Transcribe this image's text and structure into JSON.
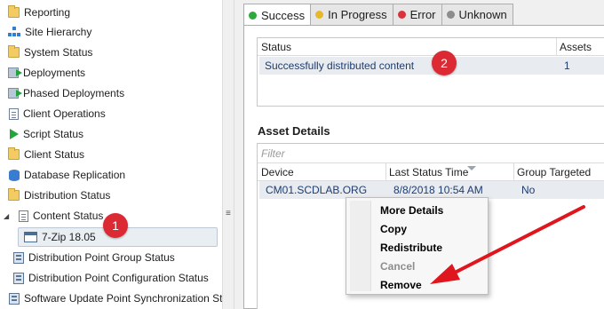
{
  "nav": {
    "items": [
      {
        "label": "Reporting",
        "icon": "folder-icon"
      },
      {
        "label": "Site Hierarchy",
        "icon": "hierarchy-icon"
      },
      {
        "label": "System Status",
        "icon": "folder-icon"
      },
      {
        "label": "Deployments",
        "icon": "deployment-icon"
      },
      {
        "label": "Phased Deployments",
        "icon": "deployment-icon"
      },
      {
        "label": "Client Operations",
        "icon": "document-icon"
      },
      {
        "label": "Script Status",
        "icon": "play-icon"
      },
      {
        "label": "Client Status",
        "icon": "folder-icon"
      },
      {
        "label": "Database Replication",
        "icon": "database-icon"
      },
      {
        "label": "Distribution Status",
        "icon": "folder-icon"
      },
      {
        "label": "Content Status",
        "icon": "document-icon"
      },
      {
        "label": "7-Zip 18.05",
        "icon": "application-icon"
      },
      {
        "label": "Distribution Point Group Status",
        "icon": "server-icon"
      },
      {
        "label": "Distribution Point Configuration Status",
        "icon": "server-icon"
      },
      {
        "label": "Software Update Point Synchronization Sta",
        "icon": "server-icon"
      }
    ]
  },
  "tabs": [
    {
      "label": "Success",
      "color": "#2eaa3c"
    },
    {
      "label": "In Progress",
      "color": "#e6b92a"
    },
    {
      "label": "Error",
      "color": "#d8323c"
    },
    {
      "label": "Unknown",
      "color": "#8c8c8c"
    }
  ],
  "status_table": {
    "headers": [
      "Status",
      "Assets"
    ],
    "rows": [
      [
        "Successfully distributed content",
        "1"
      ]
    ]
  },
  "asset_details": {
    "title": "Asset Details",
    "filter_placeholder": "Filter",
    "headers": [
      "Device",
      "Last Status Time",
      "Group Targeted"
    ],
    "rows": [
      [
        "CM01.SCDLAB.ORG",
        "8/8/2018 10:54 AM",
        "No"
      ]
    ]
  },
  "context_menu": {
    "items": [
      {
        "label": "More Details",
        "enabled": true
      },
      {
        "label": "Copy",
        "enabled": true
      },
      {
        "label": "Redistribute",
        "enabled": true
      },
      {
        "label": "Cancel",
        "enabled": false
      },
      {
        "label": "Remove",
        "enabled": true
      }
    ]
  },
  "badges": [
    "1",
    "2"
  ],
  "colors": {
    "badge": "#dc2a35",
    "selection": "#e8ebef"
  }
}
